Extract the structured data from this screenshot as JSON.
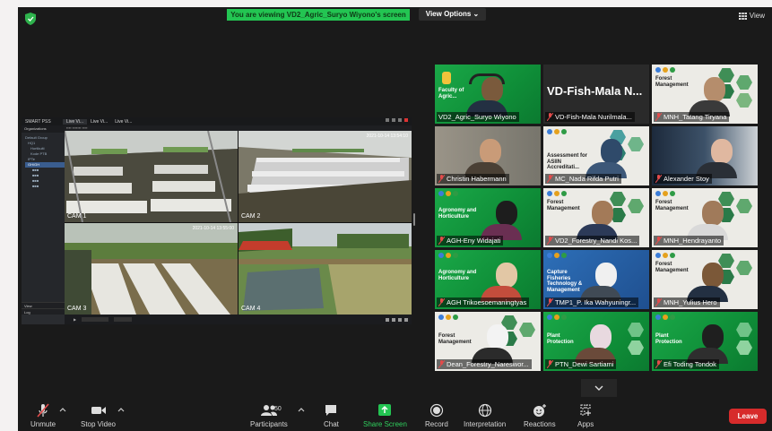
{
  "banner": {
    "text": "You are viewing VD2_Agric_Suryo Wiyono's screen"
  },
  "view_options": {
    "label": "View Options ⌄"
  },
  "view_button": {
    "label": "View"
  },
  "shared_app": {
    "brand": "SMART PSS",
    "tabs": [
      "Live Vi...",
      "Live Vi...",
      "Live Vi..."
    ],
    "panel_header": "Organizations",
    "tree": [
      "Default Group",
      "HQ1",
      "Hortikulti",
      "Kode PTB",
      "IPTe",
      "GH/GH"
    ],
    "panel_bottom": [
      "View",
      "Log"
    ],
    "cameras": [
      {
        "label": "CAM 1",
        "timestamp": ""
      },
      {
        "label": "CAM 2",
        "timestamp": "2021-10-14 13:54:10"
      },
      {
        "label": "CAM 3",
        "timestamp": "2021-10-14 13:55:00"
      },
      {
        "label": "CAM 4",
        "timestamp": ""
      }
    ]
  },
  "participants": [
    {
      "name": "VD2_Agric_Suryo Wiyono",
      "slide": "Faculty of Agric...",
      "bg": "green",
      "active": true,
      "video_only": false
    },
    {
      "name": "VD-Fish-Mala Nurilmala...",
      "big_name": "VD-Fish-Mala  N...",
      "bg": "black",
      "active": false
    },
    {
      "name": "MNH_Tatang Tiryana",
      "slide": "Forest Management",
      "bg": "cream"
    },
    {
      "name": "Christin Habermann",
      "bg": "room"
    },
    {
      "name": "MC_Nada Rifda Putri",
      "slide": "Assessment for ASIIN Accreditati...",
      "bg": "cream"
    },
    {
      "name": "Alexander Stoy",
      "bg": "office"
    },
    {
      "name": "AGH-Eny Widajati",
      "slide": "Agronomy and Horticulture",
      "bg": "green"
    },
    {
      "name": "VD2_Forestry_Nandi Kos...",
      "slide": "Forest Management",
      "bg": "cream"
    },
    {
      "name": "MNH_Hendrayanto",
      "slide": "Forest Management",
      "bg": "cream"
    },
    {
      "name": "AGH Trikoesoemaningtyas",
      "slide": "Agronomy and Horticulture",
      "bg": "green"
    },
    {
      "name": "TMP1_P. Ika Wahyuningr...",
      "slide": "Capture Fisheries Technology & Management",
      "bg": "blue"
    },
    {
      "name": "MNH_Yulius Hero",
      "slide": "Forest Management",
      "bg": "cream"
    },
    {
      "name": "Dean_Forestry_Nareswor...",
      "slide": "Forest Management",
      "bg": "cream"
    },
    {
      "name": "PTN_Dewi Sartiami",
      "slide": "Plant Protection",
      "bg": "green"
    },
    {
      "name": "Efi Toding Tondok",
      "slide": "Plant Protection",
      "bg": "green"
    }
  ],
  "toolbar": {
    "unmute": "Unmute",
    "stop_video": "Stop Video",
    "participants": "Participants",
    "participants_count": "50",
    "chat": "Chat",
    "share_screen": "Share Screen",
    "record": "Record",
    "interpretation": "Interpretation",
    "reactions": "Reactions",
    "apps": "Apps",
    "leave": "Leave"
  },
  "colors": {
    "share_green": "#23c552",
    "leave_red": "#d72b2b",
    "active_speaker": "#e2e235"
  }
}
